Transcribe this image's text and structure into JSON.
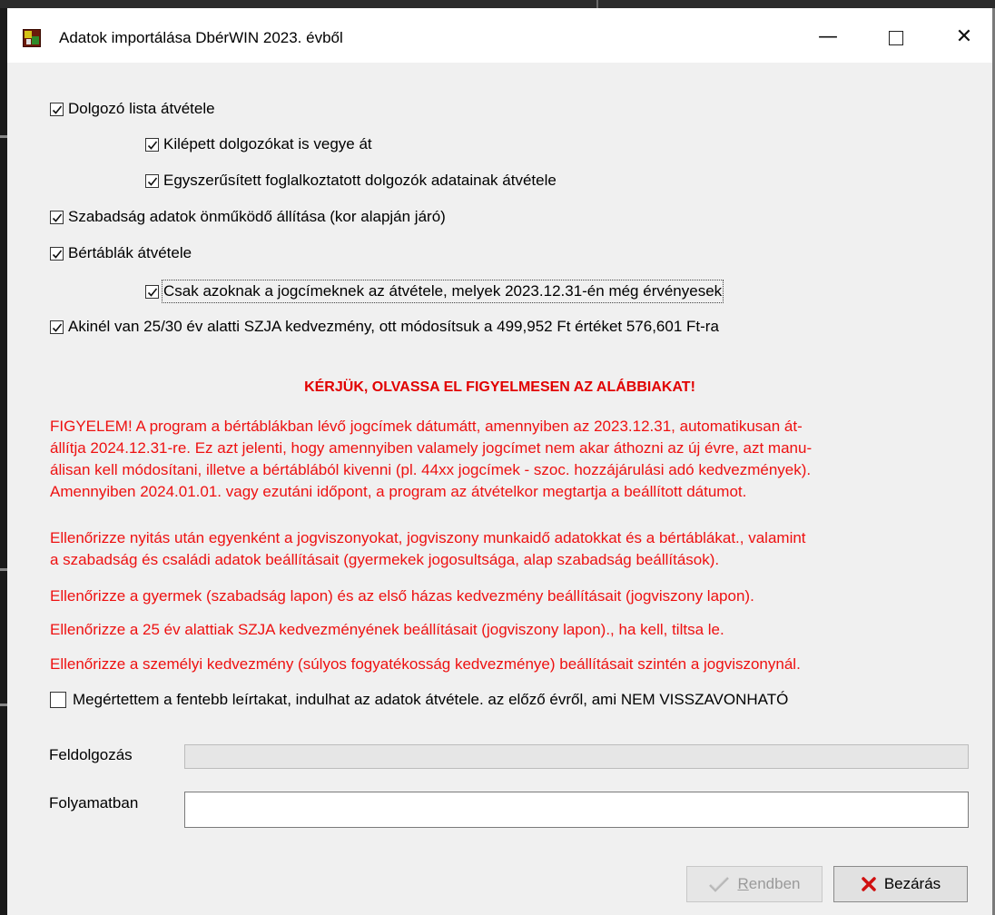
{
  "window": {
    "title": "Adatok importálása DbérWIN 2023. évből",
    "controls": {
      "minimize": "—",
      "close": "✕"
    }
  },
  "options": [
    {
      "label": "Dolgozó lista átvétele",
      "checked": true
    },
    {
      "label": "Kilépett dolgozókat is vegye át",
      "checked": true
    },
    {
      "label": "Egyszerűsített foglalkoztatott dolgozók adatainak átvétele",
      "checked": true
    },
    {
      "label": "Szabadság adatok önműködő állítása (kor alapján járó)",
      "checked": true
    },
    {
      "label": "Bértáblák átvétele",
      "checked": true
    },
    {
      "label": "Csak azoknak a jogcímeknek az átvétele, melyek 2023.12.31-én még érvényesek",
      "checked": true
    },
    {
      "label": "Akinél van 25/30 év alatti SZJA kedvezmény, ott módosítsuk a 499,952 Ft értéket 576,601 Ft-ra",
      "checked": true
    }
  ],
  "warning": {
    "title": "KÉRJÜK, OLVASSA EL FIGYELMESEN AZ ALÁBBIAKAT!",
    "paragraphs": [
      {
        "lines": [
          "FIGYELEM! A program a bértáblákban lévő jogcímek dátumátt, amennyiben az 2023.12.31, automatikusan át-",
          "állítja 2024.12.31-re. Ez azt jelenti, hogy amennyiben valamely jogcímet nem akar áthozni az új évre, azt manu-",
          "álisan kell módosítani, illetve a bértáblából kivenni (pl. 44xx jogcímek  - szoc. hozzájárulási adó kedvezmények).",
          "Amennyiben 2024.01.01. vagy ezutáni időpont, a program az átvételkor megtartja a beállított dátumot."
        ]
      },
      {
        "lines": [
          "Ellenőrizze nyitás után egyenként a jogviszonyokat, jogviszony munkaidő adatokkat és a bértáblákat., valamint",
          "a szabadság és családi adatok beállításait (gyermekek jogosultsága, alap szabadság beállítások)."
        ]
      },
      {
        "lines": [
          "Ellenőrizze a gyermek (szabadság lapon) és az első házas kedvezmény beállításait (jogviszony lapon)."
        ]
      },
      {
        "lines": [
          "Ellenőrizze a 25 év alattiak SZJA kedvezményének beállításait (jogviszony lapon)., ha kell, tiltsa le."
        ]
      },
      {
        "lines": [
          "Ellenőrizze a személyi kedvezmény (súlyos fogyatékosság kedvezménye) beállításait szintén a jogviszonynál."
        ]
      }
    ]
  },
  "confirm": {
    "label": "Megértettem a fentebb leírtakat, indulhat az adatok átvétele. az előző évről, ami NEM VISSZAVONHATÓ",
    "checked": false
  },
  "processing": {
    "label": "Feldolgozás",
    "progress": 0
  },
  "in_progress": {
    "label": "Folyamatban",
    "value": ""
  },
  "buttons": {
    "ok": {
      "underlined": "R",
      "rest": "endben",
      "enabled": false
    },
    "close": {
      "label": "Bezárás"
    }
  },
  "colors": {
    "warning": "#ee1111",
    "accent": "#e10000"
  }
}
